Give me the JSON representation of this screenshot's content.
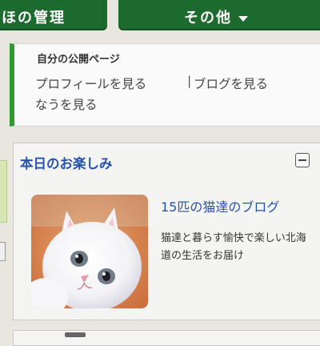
{
  "tabs": {
    "manage_label": "ほの管理",
    "other_label": "その他"
  },
  "public_page": {
    "title": "自分の公開ページ",
    "profile_link": "プロフィールを見る",
    "separator": "|",
    "blog_link": "ブログを見る",
    "now_link": "なうを見る"
  },
  "fun_today": {
    "title": "本日のお楽しみ",
    "blog_title": "15匹の猫達のブログ",
    "description": "猫達と暮らす愉快で楽しい北海道の生活をお届け"
  },
  "colors": {
    "tab_green": "#1c6a2e",
    "accent_green": "#2f9a31",
    "link_blue": "#2452b3"
  },
  "icons": [
    "caret-down-icon",
    "collapse-icon"
  ]
}
